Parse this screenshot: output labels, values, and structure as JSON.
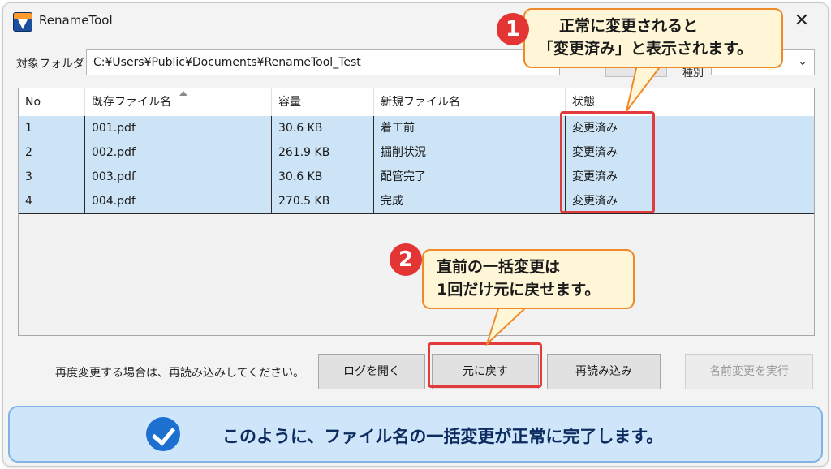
{
  "window": {
    "title": "RenameTool",
    "close_label": "✕"
  },
  "folder": {
    "label": "対象フォルダ",
    "value": "C:¥Users¥Public¥Documents¥RenameTool_Test"
  },
  "sort": {
    "label": "種別"
  },
  "table": {
    "columns": [
      "No",
      "既存ファイル名",
      "容量",
      "新規ファイル名",
      "状態"
    ],
    "rows": [
      [
        "1",
        "001.pdf",
        "30.6 KB",
        "着工前",
        "変更済み"
      ],
      [
        "2",
        "002.pdf",
        "261.9 KB",
        "掘削状況",
        "変更済み"
      ],
      [
        "3",
        "003.pdf",
        "30.6 KB",
        "配管完了",
        "変更済み"
      ],
      [
        "4",
        "004.pdf",
        "270.5 KB",
        "完成",
        "変更済み"
      ]
    ]
  },
  "footer": {
    "hint": "再度変更する場合は、再読み込みしてください。",
    "buttons": {
      "open_log": "ログを開く",
      "undo": "元に戻す",
      "reload": "再読み込み",
      "execute": "名前変更を実行"
    }
  },
  "callouts": {
    "c1": {
      "badge": "1",
      "line1": "正常に変更されると",
      "line2": "「変更済み」と表示されます。"
    },
    "c2": {
      "badge": "2",
      "line1": "直前の一括変更は",
      "line2": "1回だけ元に戻せます。"
    }
  },
  "banner": {
    "text": "このように、ファイル名の一括変更が正常に完了します。"
  },
  "colors": {
    "accent_red": "#e43535",
    "callout_border": "#ef8a2a",
    "banner_bg": "#cfe6fa",
    "row_selected": "#cde4f7"
  }
}
